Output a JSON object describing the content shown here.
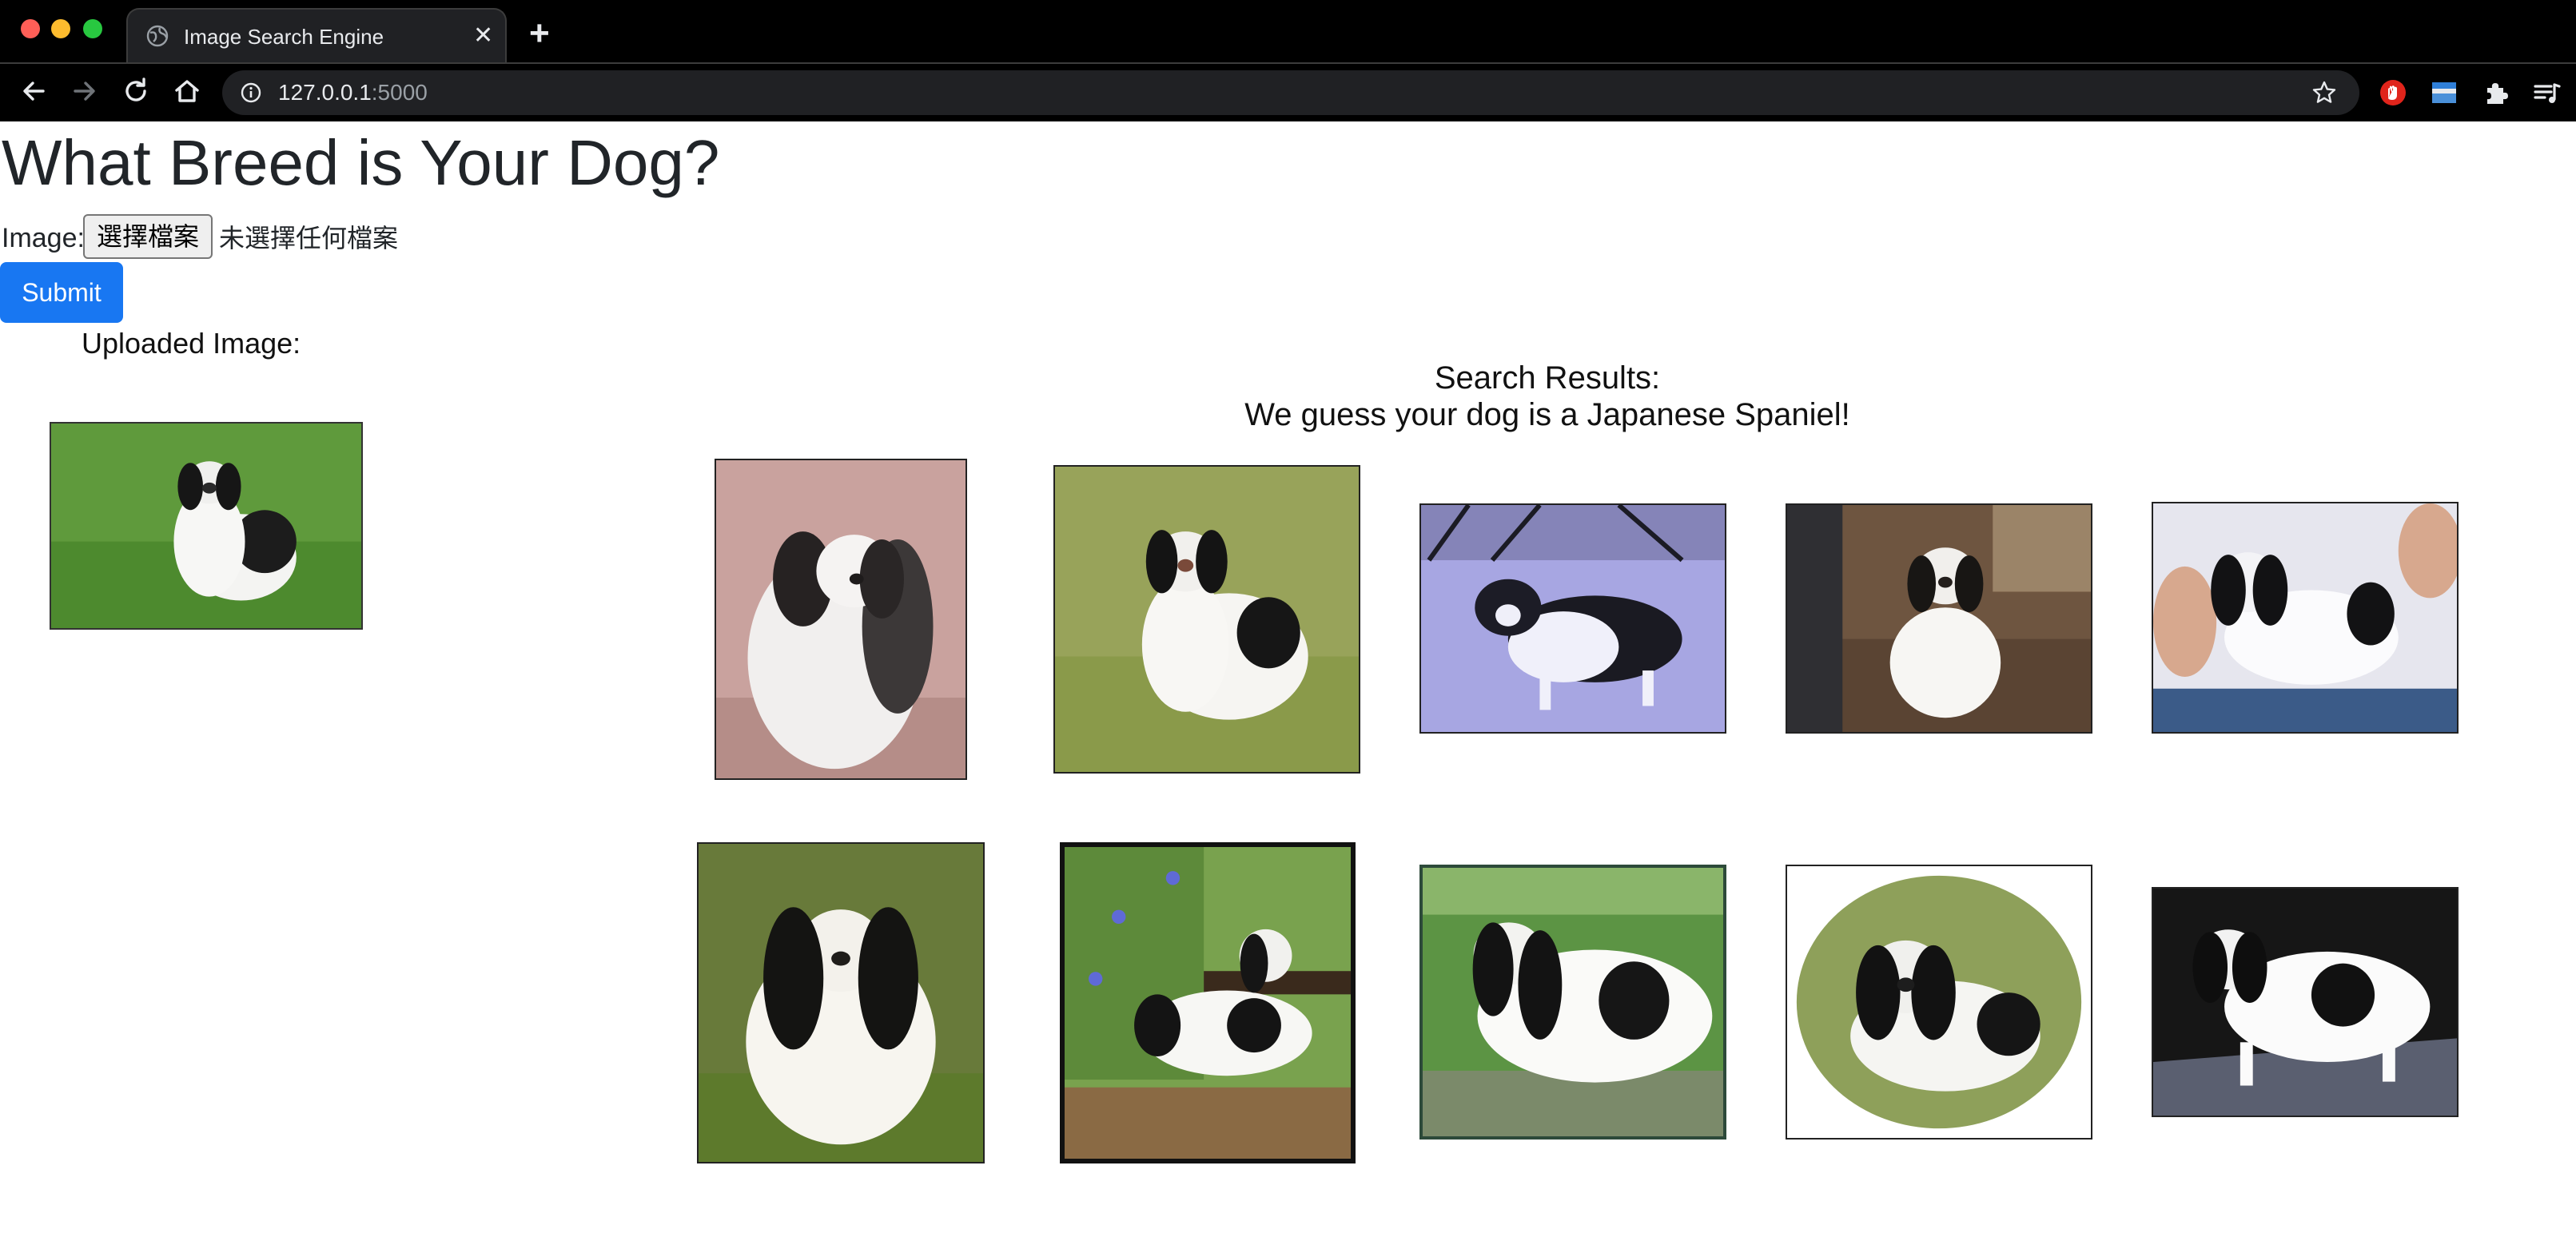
{
  "browser": {
    "tab_title": "Image Search Engine",
    "tab_close": "✕",
    "new_tab": "+",
    "url_host": "127.0.0.1",
    "url_port": ":5000"
  },
  "page": {
    "title": "What Breed is Your Dog?",
    "image_label": "Image:",
    "choose_file_label": "選擇檔案",
    "no_file_text": "未選擇任何檔案",
    "submit_label": "Submit",
    "uploaded_heading": "Uploaded Image:",
    "results_heading_line1": "Search Results:",
    "results_heading_line2": "We guess your dog is a Japanese Spaniel!"
  },
  "colors": {
    "submit_bg": "#1877f2",
    "traffic_close": "#ff5f57",
    "traffic_min": "#febc2e",
    "traffic_max": "#28c840"
  },
  "icons": [
    "back-icon",
    "forward-icon",
    "reload-icon",
    "home-icon",
    "info-icon",
    "star-icon",
    "adblock-icon",
    "window-icon",
    "puzzle-icon",
    "queue-icon",
    "globe-icon"
  ]
}
